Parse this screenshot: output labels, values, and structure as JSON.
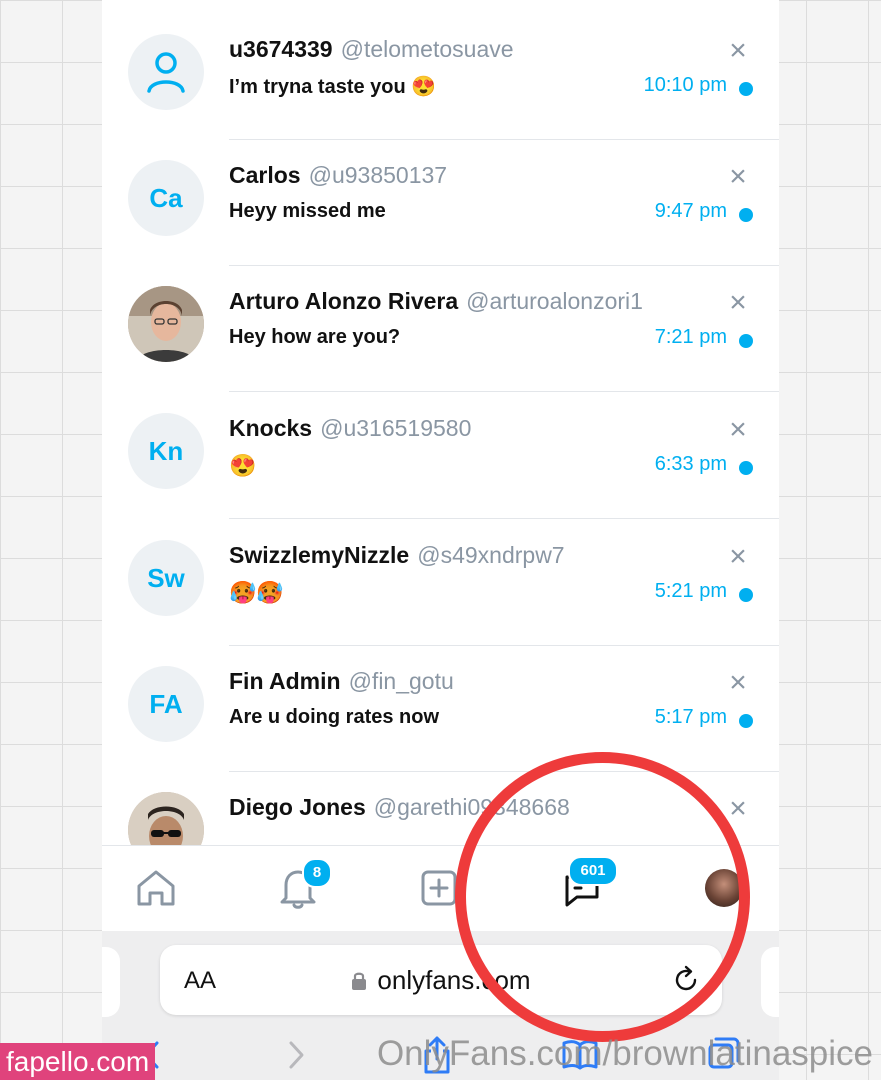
{
  "conversations": [
    {
      "name": "u3674339",
      "handle": "@telometosuave",
      "message": "I’m tryna taste you 😍",
      "time": "10:10 pm",
      "avatar": "person-icon"
    },
    {
      "name": "Carlos",
      "handle": "@u93850137",
      "message": "Heyy missed me",
      "time": "9:47 pm",
      "avatar_initials": "Ca"
    },
    {
      "name": "Arturo Alonzo Rivera",
      "handle": "@arturoalonzori1",
      "message": "Hey how are you?",
      "time": "7:21 pm",
      "avatar": "photo"
    },
    {
      "name": "Knocks",
      "handle": "@u316519580",
      "message": "😍",
      "time": "6:33 pm",
      "avatar_initials": "Kn"
    },
    {
      "name": "SwizzlemyNizzle",
      "handle": "@s49xndrpw7",
      "message": "🥵🥵",
      "time": "5:21 pm",
      "avatar_initials": "Sw"
    },
    {
      "name": "Fin Admin",
      "handle": "@fin_gotu",
      "message": "Are u doing rates now",
      "time": "5:17 pm",
      "avatar_initials": "FA"
    },
    {
      "name": "Diego Jones",
      "handle": "@garethi09348668",
      "message": "",
      "time": "",
      "avatar": "photo"
    }
  ],
  "close_symbol": "×",
  "tabbar": {
    "notifications_badge": "8",
    "messages_badge": "601",
    "icons": [
      "home-icon",
      "bell-icon",
      "plus-square-icon",
      "chat-icon",
      "profile-avatar"
    ]
  },
  "browser": {
    "aa_label": "AA",
    "url": "onlyfans.com"
  },
  "watermarks": {
    "left": "fapello.com",
    "right": "OnlyFans.com/brownlatinaspice"
  },
  "colors": {
    "accent": "#00aff0",
    "circle": "#ee3b3b",
    "watermark_bg": "#e0437c"
  }
}
